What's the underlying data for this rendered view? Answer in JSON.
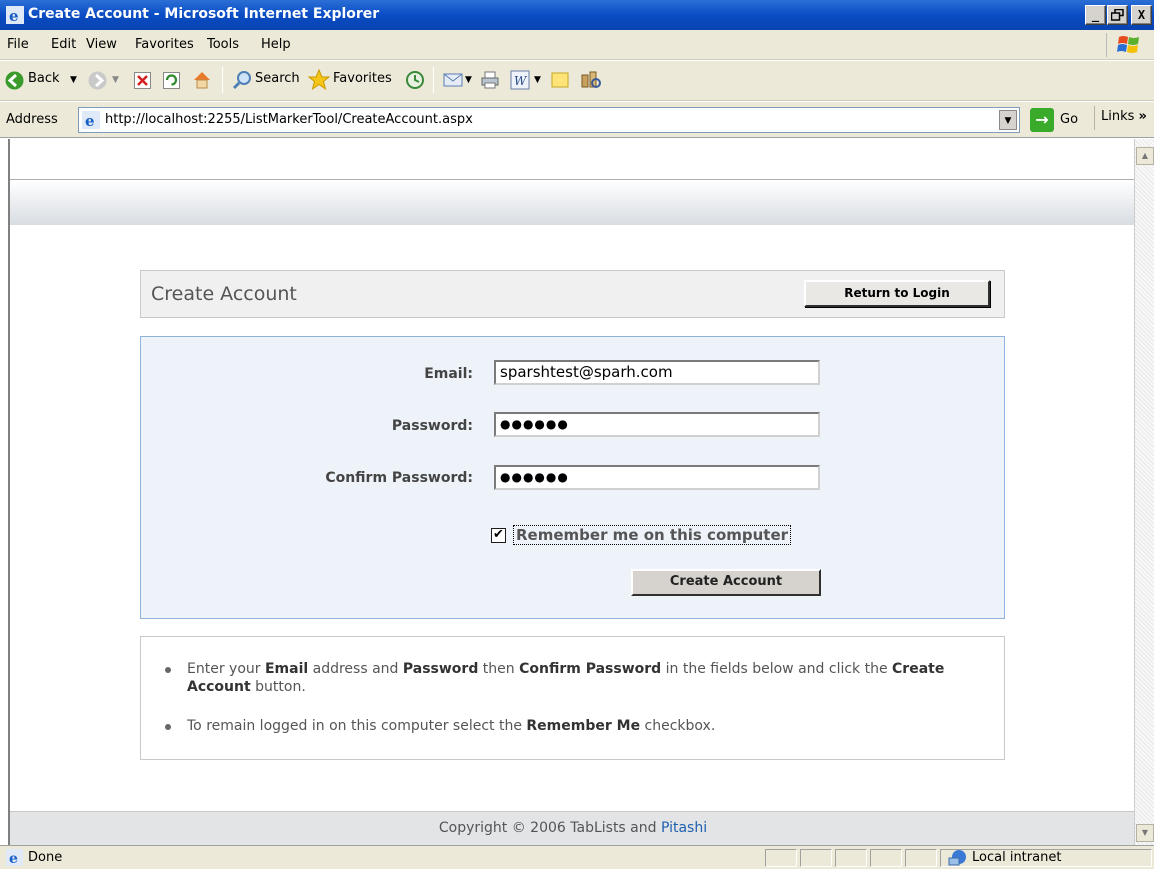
{
  "window": {
    "title": "Create Account - Microsoft Internet Explorer",
    "buttons": {
      "minimize": "_",
      "maximize": "8",
      "close": "X"
    }
  },
  "menu": {
    "items": [
      {
        "label": "File"
      },
      {
        "label": "Edit"
      },
      {
        "label": "View"
      },
      {
        "label": "Favorites"
      },
      {
        "label": "Tools"
      },
      {
        "label": "Help"
      }
    ]
  },
  "toolbar": {
    "back_label": "Back",
    "search_label": "Search",
    "favorites_label": "Favorites"
  },
  "address": {
    "label": "Address",
    "url": "http://localhost:2255/ListMarkerTool/CreateAccount.aspx",
    "go_label": "Go",
    "links_label": "Links"
  },
  "page": {
    "card_title": "Create Account",
    "return_button": "Return to Login",
    "form": {
      "email_label": "Email:",
      "email_value": "sparshtest@sparh.com",
      "password_label": "Password:",
      "password_value": "●●●●●●",
      "confirm_label": "Confirm Password:",
      "confirm_value": "●●●●●●",
      "remember_label": "Remember me on this computer",
      "remember_checked": true,
      "create_button": "Create Account"
    },
    "instructions": [
      {
        "parts": [
          {
            "t": "Enter your ",
            "b": false
          },
          {
            "t": "Email",
            "b": true
          },
          {
            "t": " address and ",
            "b": false
          },
          {
            "t": "Password",
            "b": true
          },
          {
            "t": " then ",
            "b": false
          },
          {
            "t": "Confirm Password",
            "b": true
          },
          {
            "t": " in the fields below and click the ",
            "b": false
          },
          {
            "t": "Create Account",
            "b": true
          },
          {
            "t": " button.",
            "b": false
          }
        ]
      },
      {
        "parts": [
          {
            "t": "To remain logged in on this computer select the ",
            "b": false
          },
          {
            "t": "Remember Me",
            "b": true
          },
          {
            "t": " checkbox.",
            "b": false
          }
        ]
      }
    ],
    "footer": {
      "copyright_prefix": "Copyright © 2006 TabLists and ",
      "link_text": "Pitashi"
    }
  },
  "status": {
    "text": "Done",
    "zone": "Local intranet"
  }
}
